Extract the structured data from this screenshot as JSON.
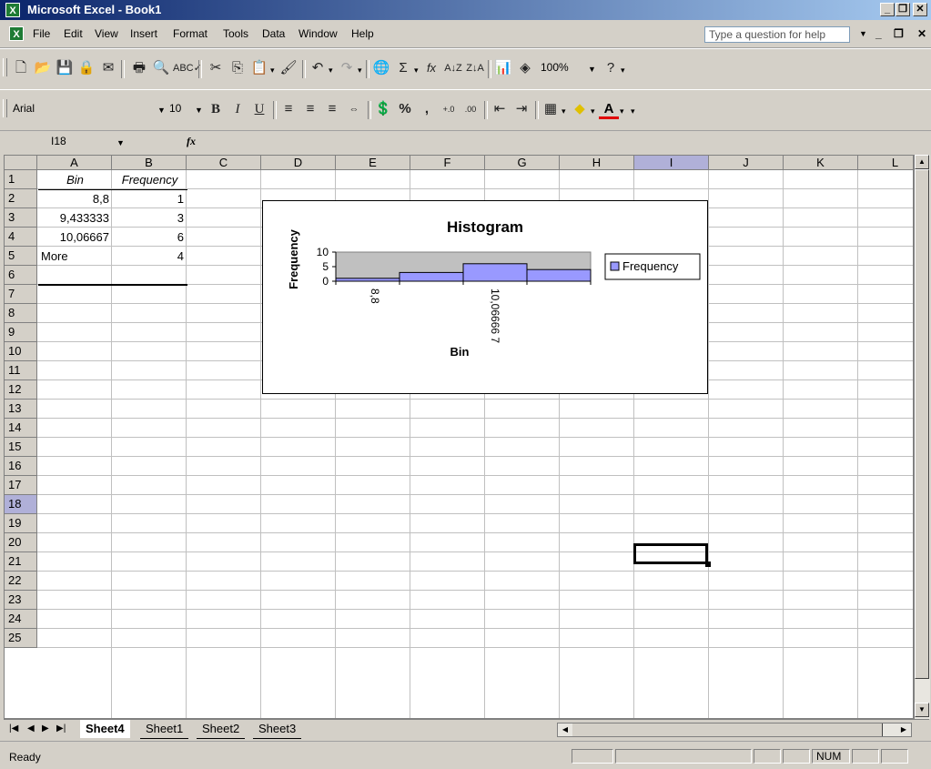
{
  "window": {
    "title": "Microsoft Excel - Book1"
  },
  "menu": {
    "items": [
      "File",
      "Edit",
      "View",
      "Insert",
      "Format",
      "Tools",
      "Data",
      "Window",
      "Help"
    ],
    "help_placeholder": "Type a question for help"
  },
  "toolbar": {
    "zoom": "100%"
  },
  "format_toolbar": {
    "font": "Arial",
    "size": "10"
  },
  "formula_bar": {
    "name_box": "I18",
    "fx": "fx",
    "formula": ""
  },
  "columns": [
    "A",
    "B",
    "C",
    "D",
    "E",
    "F",
    "G",
    "H",
    "I",
    "J",
    "K",
    "L"
  ],
  "rows": [
    "1",
    "2",
    "3",
    "4",
    "5",
    "6",
    "7",
    "8",
    "9",
    "10",
    "11",
    "12",
    "13",
    "14",
    "15",
    "16",
    "17",
    "18",
    "19",
    "20",
    "21",
    "22",
    "23",
    "24",
    "25"
  ],
  "cells": {
    "A1": "Bin",
    "B1": "Frequency",
    "A2": "8,8",
    "B2": "1",
    "A3": "9,433333",
    "B3": "3",
    "A4": "10,06667",
    "B4": "6",
    "A5": "More",
    "B5": "4"
  },
  "chart_data": {
    "type": "bar",
    "title": "Histogram",
    "xlabel": "Bin",
    "ylabel": "Frequency",
    "categories": [
      "8,8",
      "9,433333",
      "10,06666 7",
      "More"
    ],
    "visible_tick_labels": [
      "8,8",
      "10,06666 7"
    ],
    "series": [
      {
        "name": "Frequency",
        "values": [
          1,
          3,
          6,
          4
        ]
      }
    ],
    "yticks": [
      "10",
      "5",
      "0"
    ],
    "ylim": [
      0,
      10
    ],
    "legend": "right",
    "bar_color": "#9999ff"
  },
  "sheets": {
    "tabs": [
      "Sheet4",
      "Sheet1",
      "Sheet2",
      "Sheet3"
    ],
    "active": "Sheet4"
  },
  "status": {
    "text": "Ready",
    "num": "NUM"
  }
}
